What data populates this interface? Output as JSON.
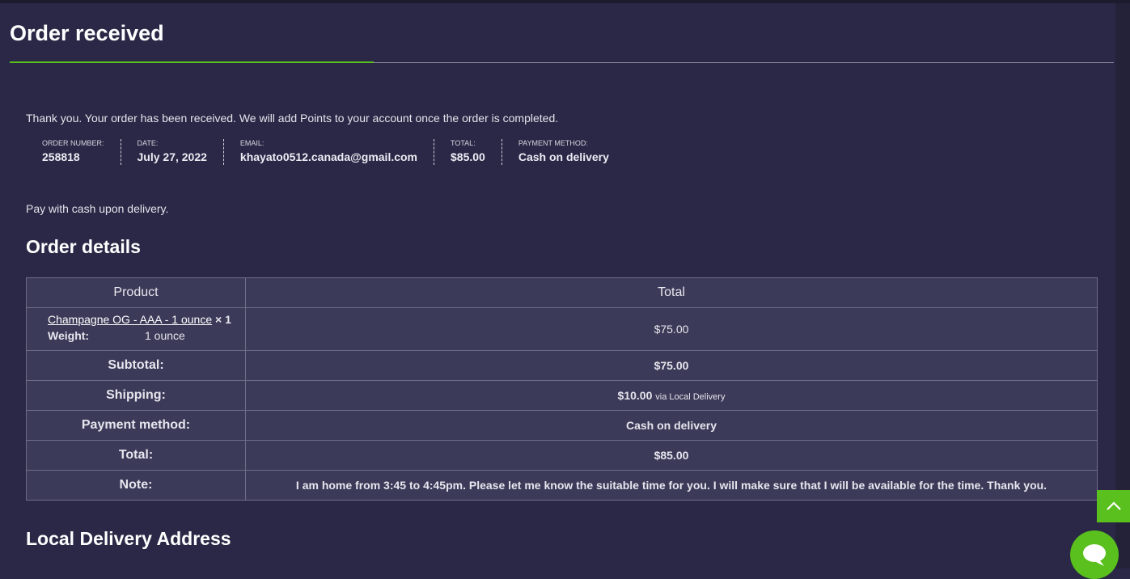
{
  "page": {
    "title": "Order received"
  },
  "thanks_text": "Thank you. Your order has been received. We will add Points to your account once the order is completed.",
  "overview": [
    {
      "label": "ORDER NUMBER:",
      "value": "258818"
    },
    {
      "label": "DATE:",
      "value": "July 27, 2022"
    },
    {
      "label": "EMAIL:",
      "value": "khayato0512.canada@gmail.com"
    },
    {
      "label": "TOTAL:",
      "value": "$85.00"
    },
    {
      "label": "PAYMENT METHOD:",
      "value": "Cash on delivery"
    }
  ],
  "payment_instructions": "Pay with cash upon delivery.",
  "order_details": {
    "heading": "Order details",
    "columns": {
      "product": "Product",
      "total": "Total"
    },
    "item": {
      "name": "Champagne OG - AAA - 1 ounce",
      "qty": "× 1",
      "meta_key": "Weight:",
      "meta_value": "1 ounce",
      "total": "$75.00"
    },
    "rows": {
      "subtotal": {
        "label": "Subtotal:",
        "value": "$75.00"
      },
      "shipping": {
        "label": "Shipping:",
        "value": "$10.00",
        "via": "via Local Delivery"
      },
      "payment": {
        "label": "Payment method:",
        "value": "Cash on delivery"
      },
      "total": {
        "label": "Total:",
        "value": "$85.00"
      },
      "note": {
        "label": "Note:",
        "value": "I am home from 3:45 to 4:45pm. Please let me know the suitable time for you. I will make sure that I will be available for the time. Thank you."
      }
    }
  },
  "delivery_heading": "Local Delivery Address",
  "icons": {
    "scroll_top": "chevron-up-icon",
    "chat": "chat-bubble-icon"
  },
  "colors": {
    "background": "#2a2846",
    "accent": "#59c01e",
    "table_bg": "#3b3a58"
  }
}
